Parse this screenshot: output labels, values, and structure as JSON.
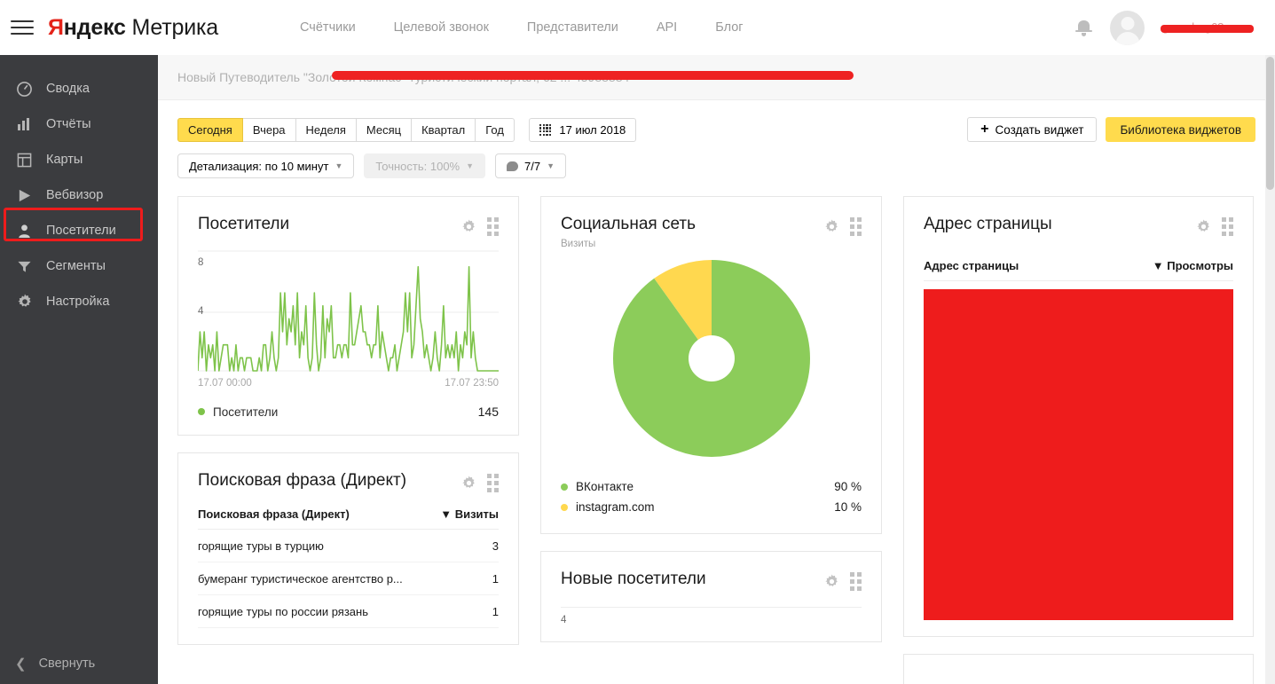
{
  "header": {
    "menu_icon": "hamburger-icon",
    "logo_ya": "Я",
    "logo_yandex_rest": "ндекс",
    "logo_metrika": "Метрика",
    "nav": [
      {
        "label": "Счётчики"
      },
      {
        "label": "Целевой звонок"
      },
      {
        "label": "Представители"
      },
      {
        "label": "API"
      },
      {
        "label": "Блог"
      }
    ],
    "bell_icon": "notification-bell-icon",
    "avatar_icon": "user-avatar-icon",
    "username": "greenbug68",
    "username_redacted": true
  },
  "sidebar": {
    "items": [
      {
        "label": "Сводка",
        "icon": "speedometer-icon",
        "active": false
      },
      {
        "label": "Отчёты",
        "icon": "bar-chart-icon",
        "active": false
      },
      {
        "label": "Карты",
        "icon": "layout-map-icon",
        "active": false
      },
      {
        "label": "Вебвизор",
        "icon": "play-icon",
        "active": false
      },
      {
        "label": "Посетители",
        "icon": "person-icon",
        "active": true
      },
      {
        "label": "Сегменты",
        "icon": "funnel-icon",
        "active": false
      },
      {
        "label": "Настройка",
        "icon": "gear-icon",
        "active": false
      }
    ],
    "collapse_label": "Свернуть",
    "collapse_icon": "chevron-left-icon",
    "highlight_color": "#ee1c1c"
  },
  "counter_bar": {
    "text": "Новый Путеводитель \"Золотой Компас\" туристический портал, 62 ... 45988884",
    "redacted": true,
    "redaction_color": "#ee2222"
  },
  "toolbar": {
    "periods": [
      {
        "label": "Сегодня",
        "active": true
      },
      {
        "label": "Вчера",
        "active": false
      },
      {
        "label": "Неделя",
        "active": false
      },
      {
        "label": "Месяц",
        "active": false
      },
      {
        "label": "Квартал",
        "active": false
      },
      {
        "label": "Год",
        "active": false
      }
    ],
    "date_label": "17 июл 2018",
    "date_icon": "calendar-icon",
    "create_widget_label": "Создать виджет",
    "create_widget_icon": "plus-icon",
    "library_label": "Библиотека виджетов",
    "accent_yellow": "#ffdb4d",
    "detail_label": "Детализация: по 10 минут",
    "accuracy_label": "Точность: 100%",
    "accuracy_disabled": true,
    "comments_label": "7/7",
    "comments_icon": "speech-bubble-icon",
    "caret_icon": "chevron-down-icon"
  },
  "widgets": {
    "visitors": {
      "title": "Посетители",
      "gear_icon": "gear-icon",
      "grip_icon": "grid-dots-icon",
      "legend_label": "Посетители",
      "legend_value": "145",
      "x_start": "17.07 00:00",
      "x_end": "17.07 23:50"
    },
    "search_phrase": {
      "title": "Поисковая фраза (Директ)",
      "gear_icon": "gear-icon",
      "grip_icon": "grid-dots-icon",
      "col1": "Поисковая фраза (Директ)",
      "col2": "▼ Визиты",
      "rows": [
        {
          "phrase": "горящие туры в турцию",
          "visits": "3"
        },
        {
          "phrase": "бумеранг туристическое агентство р...",
          "visits": "1"
        },
        {
          "phrase": "горящие туры по россии рязань",
          "visits": "1"
        }
      ]
    },
    "social": {
      "title": "Социальная сеть",
      "subtitle": "Визиты",
      "gear_icon": "gear-icon",
      "grip_icon": "grid-dots-icon",
      "legend": [
        {
          "label": "ВКонтакте",
          "value": "90 %",
          "color": "#8ccc5a"
        },
        {
          "label": "instagram.com",
          "value": "10 %",
          "color": "#ffd84f"
        }
      ]
    },
    "new_visitors": {
      "title": "Новые посетители",
      "gear_icon": "gear-icon",
      "grip_icon": "grid-dots-icon",
      "y_label": "4"
    },
    "page_address": {
      "title": "Адрес страницы",
      "gear_icon": "gear-icon",
      "grip_icon": "grid-dots-icon",
      "col1": "Адрес страницы",
      "col2": "▼ Просмотры",
      "content_redacted": true,
      "redaction_color": "#ee1c1c"
    }
  },
  "chart_data": [
    {
      "type": "line",
      "title": "Посетители",
      "xlabel": "",
      "ylabel": "",
      "ylim": [
        0,
        9
      ],
      "yticks": [
        4,
        8
      ],
      "x_start": "17.07 00:00",
      "x_end": "17.07 23:50",
      "grid": true,
      "legend_position": "bottom",
      "series": [
        {
          "name": "Посетители",
          "color": "#7ec34a",
          "total": 145,
          "values": [
            0,
            3,
            1,
            3,
            0,
            2,
            1,
            2,
            0,
            3,
            0,
            1,
            2,
            2,
            2,
            0,
            1,
            0,
            2,
            0,
            1,
            1,
            0,
            1,
            1,
            1,
            0,
            0,
            0,
            1,
            0,
            2,
            2,
            0,
            1,
            3,
            1,
            0,
            1,
            6,
            3,
            6,
            2,
            4,
            3,
            5,
            2,
            6,
            1,
            3,
            2,
            5,
            1,
            0,
            1,
            6,
            2,
            0,
            1,
            5,
            1,
            4,
            3,
            5,
            1,
            1,
            2,
            2,
            1,
            2,
            2,
            1,
            6,
            2,
            2,
            3,
            4,
            5,
            3,
            3,
            2,
            2,
            1,
            2,
            2,
            5,
            1,
            3,
            2,
            1,
            0,
            1,
            1,
            2,
            0,
            1,
            2,
            3,
            6,
            3,
            6,
            1,
            2,
            5,
            8,
            4,
            3,
            1,
            2,
            1,
            0,
            1,
            3,
            1,
            0,
            2,
            5,
            1,
            2,
            1,
            2,
            1,
            3,
            0,
            2,
            1,
            3,
            2,
            8,
            1,
            3,
            1,
            0,
            0,
            0,
            0,
            0,
            0,
            0,
            0,
            0,
            0,
            0
          ]
        }
      ]
    },
    {
      "type": "pie",
      "title": "Социальная сеть",
      "subtitle": "Визиты",
      "donut": true,
      "labels": [
        "ВКонтакте",
        "instagram.com"
      ],
      "values": [
        90,
        10
      ],
      "colors": [
        "#8ccc5a",
        "#ffd84f"
      ],
      "legend_position": "bottom"
    },
    {
      "type": "table",
      "title": "Поисковая фраза (Директ)",
      "columns": [
        "Поисковая фраза (Директ)",
        "▼ Визиты"
      ],
      "rows": [
        [
          "горящие туры в турцию",
          "3"
        ],
        [
          "бумеранг туристическое агентство р...",
          "1"
        ],
        [
          "горящие туры по россии рязань",
          "1"
        ]
      ]
    },
    {
      "type": "table",
      "title": "Адрес страницы",
      "columns": [
        "Адрес страницы",
        "▼ Просмотры"
      ],
      "rows": [],
      "note": "content redacted by solid red block"
    }
  ]
}
